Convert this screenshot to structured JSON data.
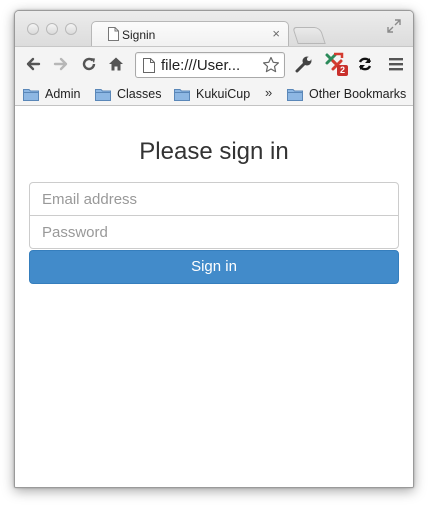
{
  "tab": {
    "title": "Signin",
    "close_glyph": "×"
  },
  "toolbar": {
    "url": "file:///User..."
  },
  "bookmarks": {
    "items": [
      {
        "label": "Admin"
      },
      {
        "label": "Classes"
      },
      {
        "label": "KukuiCup"
      }
    ],
    "overflow_glyph": "»",
    "other": "Other Bookmarks"
  },
  "extension": {
    "badge": "2"
  },
  "colors": {
    "accent": "#428bca",
    "badge": "#c9302c"
  },
  "icons": [
    "document-icon",
    "close-icon",
    "fullscreen-icon",
    "back-icon",
    "forward-icon",
    "reload-icon",
    "home-icon",
    "star-icon",
    "wrench-icon",
    "extension-icon",
    "sync-icon",
    "menu-icon",
    "folder-icon"
  ],
  "form": {
    "heading": "Please sign in",
    "email_placeholder": "Email address",
    "password_placeholder": "Password",
    "submit_label": "Sign in"
  }
}
